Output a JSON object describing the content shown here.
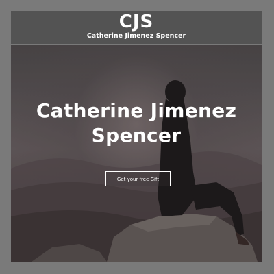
{
  "header": {
    "logo": "CJS",
    "tagline": "Catherine Jimenez Spencer"
  },
  "hero": {
    "title_line1": "Catherine Jimenez",
    "title_line2": "Spencer",
    "cta_label": "Get your free Gift",
    "image": "woman-sitting-on-mountain-rock-photo"
  },
  "colors": {
    "page_border": "#7a7a7a",
    "header_bg": "#555555",
    "text": "#ffffff"
  }
}
